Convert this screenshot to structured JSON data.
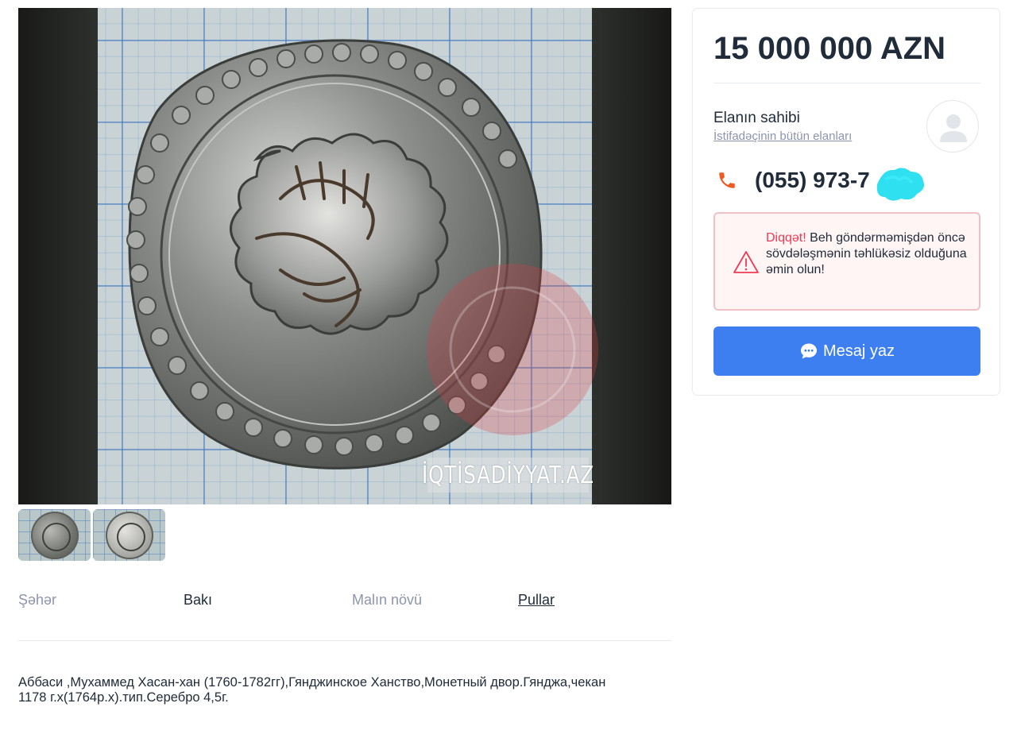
{
  "gallery": {
    "main_image": "coin-photo",
    "watermark": "İQTİSADİYYAT.AZ",
    "thumbnails": [
      "coin-photo-1",
      "coin-photo-2"
    ]
  },
  "properties": [
    {
      "label": "Şəhər",
      "value": "Bakı"
    },
    {
      "label": "Malın növü",
      "value": "Pullar"
    }
  ],
  "description": "Аббаси ,Мухаммед Хасан-хан (1760-1782гг),Гянджинское Ханство,Монетный двор.Гянджа,чекан 1178 г.х(1764р.х).тип.Серебро 4,5г.",
  "sidebar": {
    "price": "15 000 000 AZN",
    "owner_label": "Elanın sahibi",
    "owner_link": "İstifadəçinin bütün elanları",
    "phone": "(055) 973-7",
    "warning_highlight": "Diqqət!",
    "warning_text": " Beh göndərməmişdən öncə sövdələşmənin təhlükəsiz olduğuna əmin olun!",
    "message_button": "Mesaj yaz",
    "colors": {
      "accent_blue": "#3d7ef1",
      "warning_red": "#ee3b54",
      "phone_orange": "#f05a22",
      "mask_cyan": "#2ee0f0"
    }
  }
}
